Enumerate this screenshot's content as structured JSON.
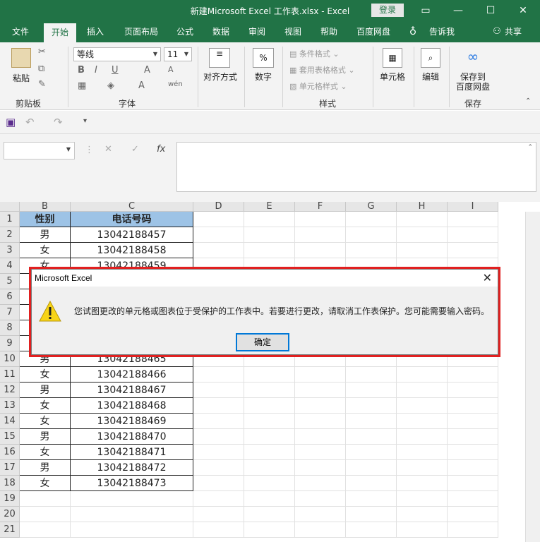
{
  "titlebar": {
    "title": "新建Microsoft Excel 工作表.xlsx  -  Excel",
    "login": "登录",
    "controls": [
      "▭",
      "—",
      "☐",
      "✕"
    ]
  },
  "tabs": [
    "文件",
    "开始",
    "插入",
    "页面布局",
    "公式",
    "数据",
    "审阅",
    "视图",
    "帮助",
    "百度网盘",
    "告诉我",
    "共享"
  ],
  "ribbon": {
    "clipboard": {
      "paste": "粘贴",
      "label": "剪贴板"
    },
    "font": {
      "name": "等线",
      "size": "11",
      "label": "字体"
    },
    "alignment": "对齐方式",
    "number": "数字",
    "styles": {
      "conditional": "条件格式",
      "table": "套用表格格式",
      "cell": "单元格样式",
      "label": "样式"
    },
    "cells": "单元格",
    "editing": "编辑",
    "save": {
      "line1": "保存到",
      "line2": "百度网盘",
      "label": "保存"
    }
  },
  "formula_bar": {
    "fx": "fx"
  },
  "columns": [
    "B",
    "C",
    "D",
    "E",
    "F",
    "G",
    "H",
    "I"
  ],
  "rows": [
    "1",
    "2",
    "3",
    "4",
    "5",
    "6",
    "7",
    "8",
    "9",
    "10",
    "11",
    "12",
    "13",
    "14",
    "15",
    "16",
    "17",
    "18",
    "19",
    "20",
    "21"
  ],
  "table": {
    "headers": [
      "性别",
      "电话号码"
    ],
    "data": [
      [
        "男",
        "13042188457"
      ],
      [
        "女",
        "13042188458"
      ],
      [
        "女",
        "13042188459"
      ],
      [
        "",
        ""
      ],
      [
        "",
        ""
      ],
      [
        "",
        ""
      ],
      [
        "",
        ""
      ],
      [
        "",
        ""
      ],
      [
        "男",
        "13042188465"
      ],
      [
        "女",
        "13042188466"
      ],
      [
        "男",
        "13042188467"
      ],
      [
        "女",
        "13042188468"
      ],
      [
        "女",
        "13042188469"
      ],
      [
        "男",
        "13042188470"
      ],
      [
        "女",
        "13042188471"
      ],
      [
        "男",
        "13042188472"
      ],
      [
        "女",
        "13042188473"
      ]
    ]
  },
  "dialog": {
    "title": "Microsoft Excel",
    "message": "您试图更改的单元格或图表位于受保护的工作表中。若要进行更改，请取消工作表保护。您可能需要输入密码。",
    "ok": "确定"
  }
}
